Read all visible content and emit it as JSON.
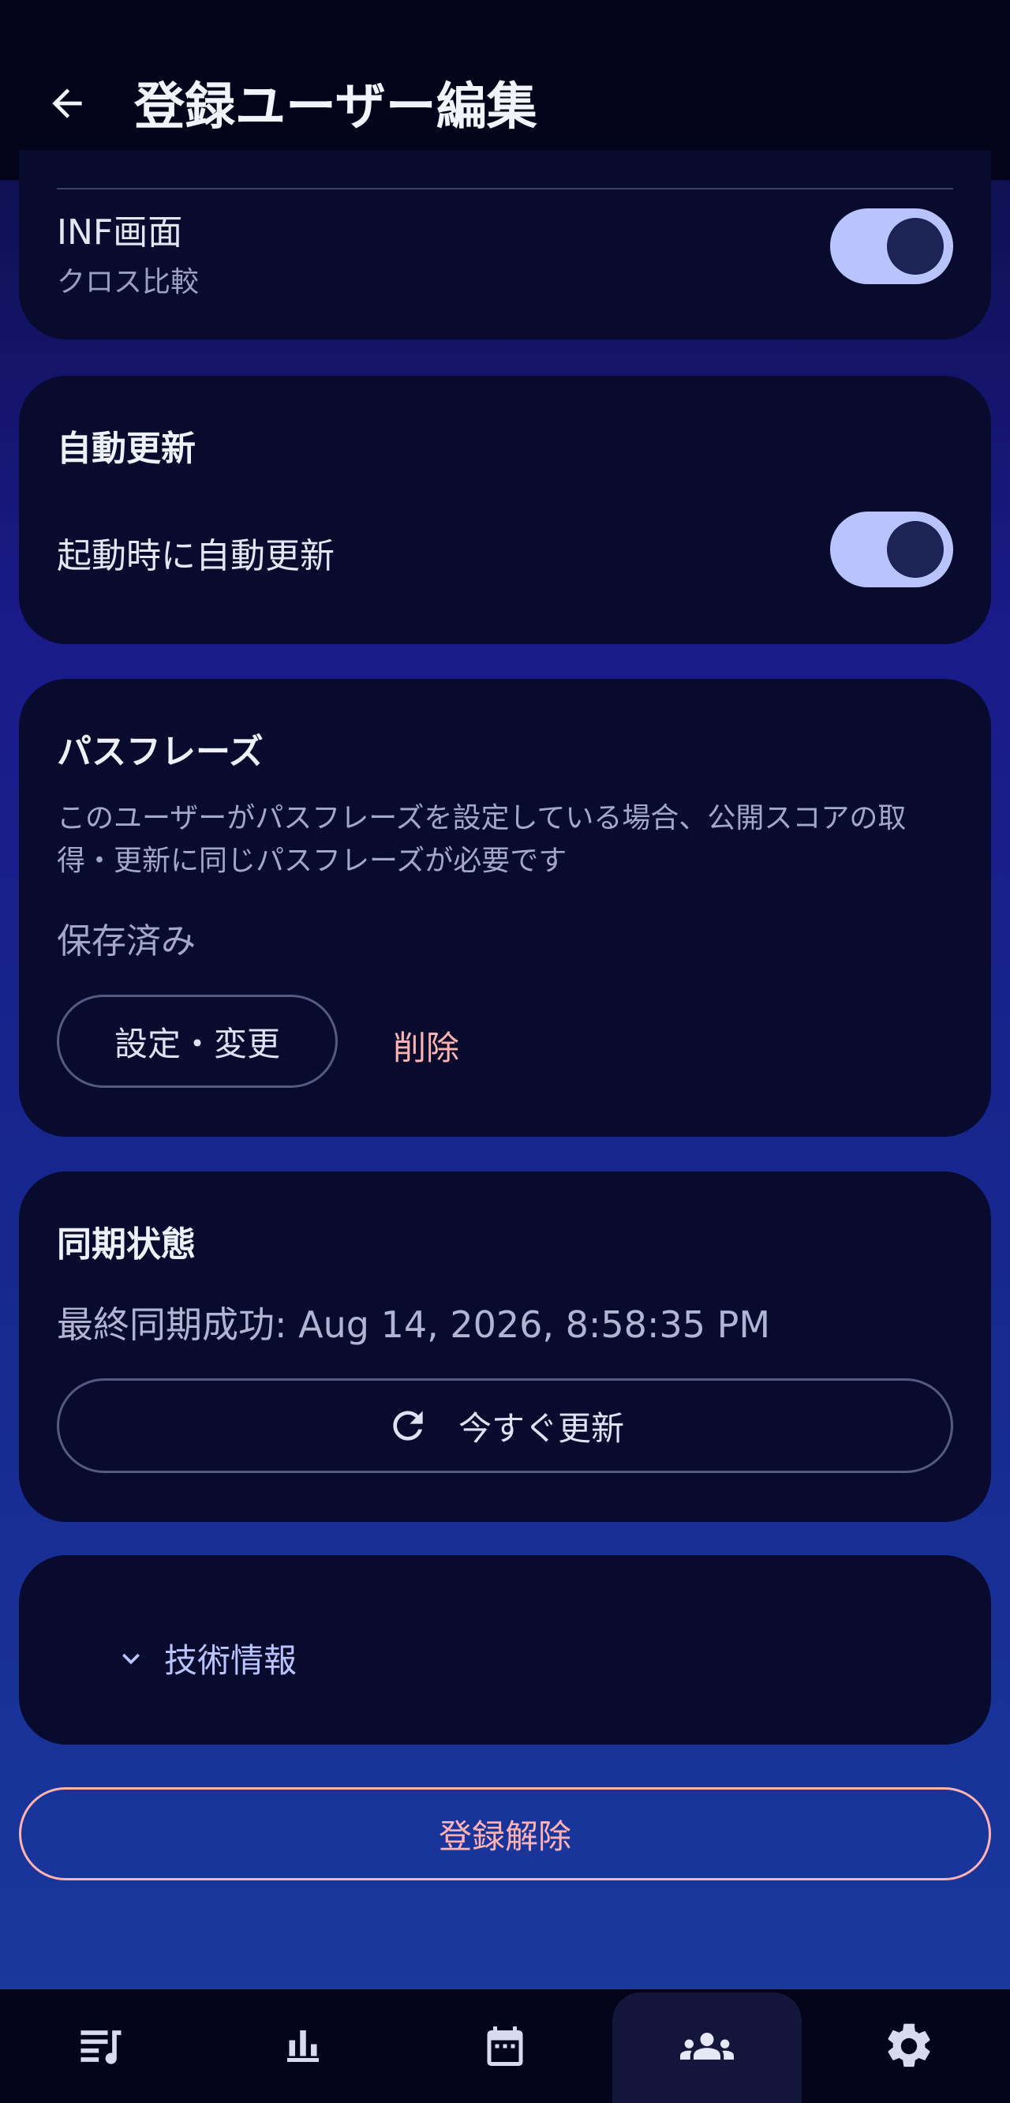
{
  "app_bar": {
    "title": "登録ユーザー編集"
  },
  "screens_card": {
    "inf_label": "INF画面",
    "inf_sub": "クロス比較",
    "inf_enabled": true
  },
  "auto_update_card": {
    "title": "自動更新",
    "row_label": "起動時に自動更新",
    "enabled": true
  },
  "passphrase_card": {
    "title": "パスフレーズ",
    "description": "このユーザーがパスフレーズを設定している場合、公開スコアの取得・更新に同じパスフレーズが必要です",
    "status": "保存済み",
    "set_button": "設定・変更",
    "delete_button": "削除"
  },
  "sync_card": {
    "title": "同期状態",
    "last_sync": "最終同期成功: Aug 14, 2026, 8:58:35 PM",
    "refresh_button": "今すぐ更新"
  },
  "tech_card": {
    "label": "技術情報"
  },
  "unregister_button": "登録解除",
  "bottom_nav": {
    "items": [
      {
        "icon": "music-list-icon"
      },
      {
        "icon": "bar-chart-icon"
      },
      {
        "icon": "calendar-icon"
      },
      {
        "icon": "users-icon",
        "active": true
      },
      {
        "icon": "gear-icon"
      }
    ]
  },
  "colors": {
    "accent": "#b9c4ff",
    "danger": "#ffb3b0",
    "card": "#080b2e",
    "bar": "#03041a"
  }
}
